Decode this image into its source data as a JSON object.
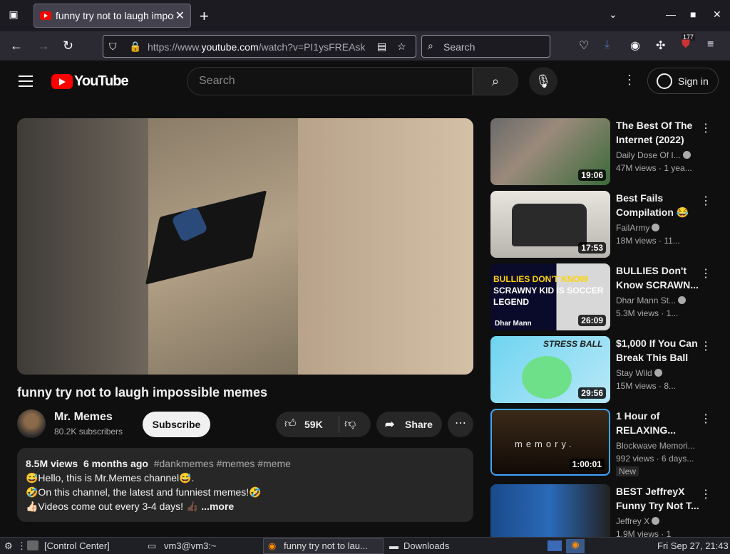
{
  "browser": {
    "tab_title": "funny try not to laugh impossible memes - YouTube",
    "tab_title_shown": "funny try not to laugh impos",
    "url_prefix": "https://www.",
    "url_host": "youtube.com",
    "url_path": "/watch?v=PI1ysFREAsk",
    "search_placeholder": "Search",
    "extension_badge": "177"
  },
  "youtube": {
    "logo_text": "YouTube",
    "search_placeholder": "Search",
    "signin_label": "Sign in"
  },
  "video": {
    "title": "funny try not to laugh impossible memes",
    "channel_name": "Mr. Memes",
    "subscribers": "80.2K subscribers",
    "subscribe_label": "Subscribe",
    "likes": "59K",
    "share_label": "Share",
    "views": "8.5M views",
    "age": "6 months ago",
    "tags": "#dankmemes #memes #meme",
    "desc_line1": "😅Hello, this is Mr.Memes channel😅.",
    "desc_line2": "🤣On this channel, the latest and funniest memes!🤣",
    "desc_line3": "👍🏻Videos come out every 3-4 days! 👍🏿",
    "more_label": "...more"
  },
  "recommendations": [
    {
      "title": "The Best Of The Internet (2022)",
      "channel": "Daily Dose Of I...",
      "views": "47M views · 1 yea...",
      "duration": "19:06"
    },
    {
      "title": "Best Fails Compilation 😂",
      "channel": "FailArmy",
      "views": "18M views · 11...",
      "duration": "17:53"
    },
    {
      "title": "BULLIES Don't Know SCRAWN...",
      "channel": "Dhar Mann St...",
      "views": "5.3M views · 1...",
      "duration": "26:09",
      "thumb_text_a": "BULLIES DON'T KNOW",
      "thumb_text_b": "SCRAWNY KID IS SOCCER LEGEND",
      "thumb_brand": "Dhar Mann"
    },
    {
      "title": "$1,000 If You Can Break This Ball i...",
      "channel": "Stay Wild",
      "views": "15M views · 8...",
      "duration": "29:56",
      "thumb_text": "STRESS BALL"
    },
    {
      "title": "1 Hour of RELAXING...",
      "channel": "Blockwave Memori...",
      "views": "992 views · 6 days...",
      "duration": "1:00:01",
      "badge": "New",
      "thumb_text": "memory."
    },
    {
      "title": "BEST JeffreyX Funny Try Not T...",
      "channel": "Jeffrey X",
      "views": "1.9M views · 1",
      "duration": ""
    }
  ],
  "taskbar": {
    "control_center": "[Control Center]",
    "terminal": "vm3@vm3:~",
    "firefox": "funny try not to lau...",
    "downloads": "Downloads",
    "clock": "Fri Sep 27, 21:43"
  }
}
